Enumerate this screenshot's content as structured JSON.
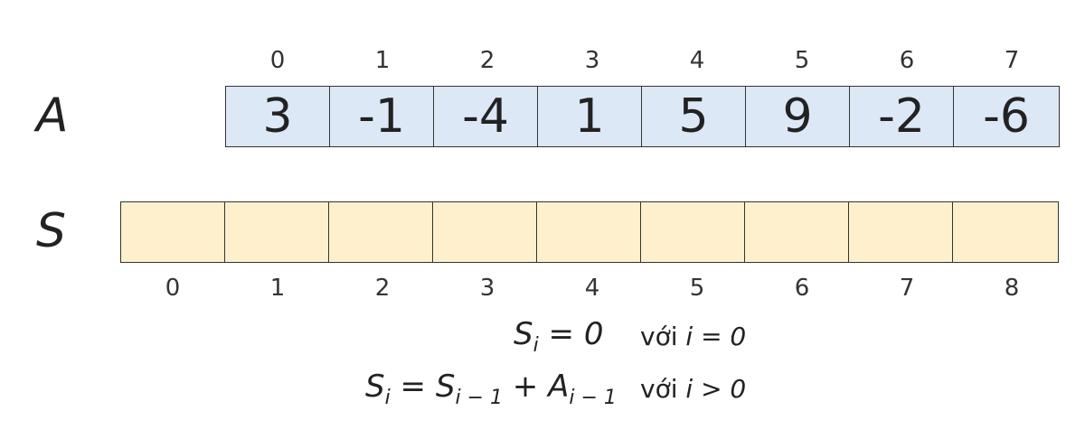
{
  "arrays": {
    "A": {
      "name": "A",
      "indices": [
        "0",
        "1",
        "2",
        "3",
        "4",
        "5",
        "6",
        "7"
      ],
      "values": [
        "3",
        "-1",
        "-4",
        "1",
        "5",
        "9",
        "-2",
        "-6"
      ],
      "fill": "#dce8f6"
    },
    "S": {
      "name": "S",
      "indices": [
        "0",
        "1",
        "2",
        "3",
        "4",
        "5",
        "6",
        "7",
        "8"
      ],
      "values": [
        "",
        "",
        "",
        "",
        "",
        "",
        "",
        "",
        ""
      ],
      "fill": "#fff0cd"
    }
  },
  "formulas": {
    "line1": {
      "lhs_base": "S",
      "lhs_sub": "i",
      "rhs": "= 0",
      "cond_word": "với",
      "cond_expr": "i = 0"
    },
    "line2": {
      "lhs_base": "S",
      "lhs_sub": "i",
      "eq": "=",
      "t1_base": "S",
      "t1_sub": "i − 1",
      "plus": "+",
      "t2_base": "A",
      "t2_sub": "i − 1",
      "cond_word": "với",
      "cond_expr": "i > 0"
    }
  }
}
